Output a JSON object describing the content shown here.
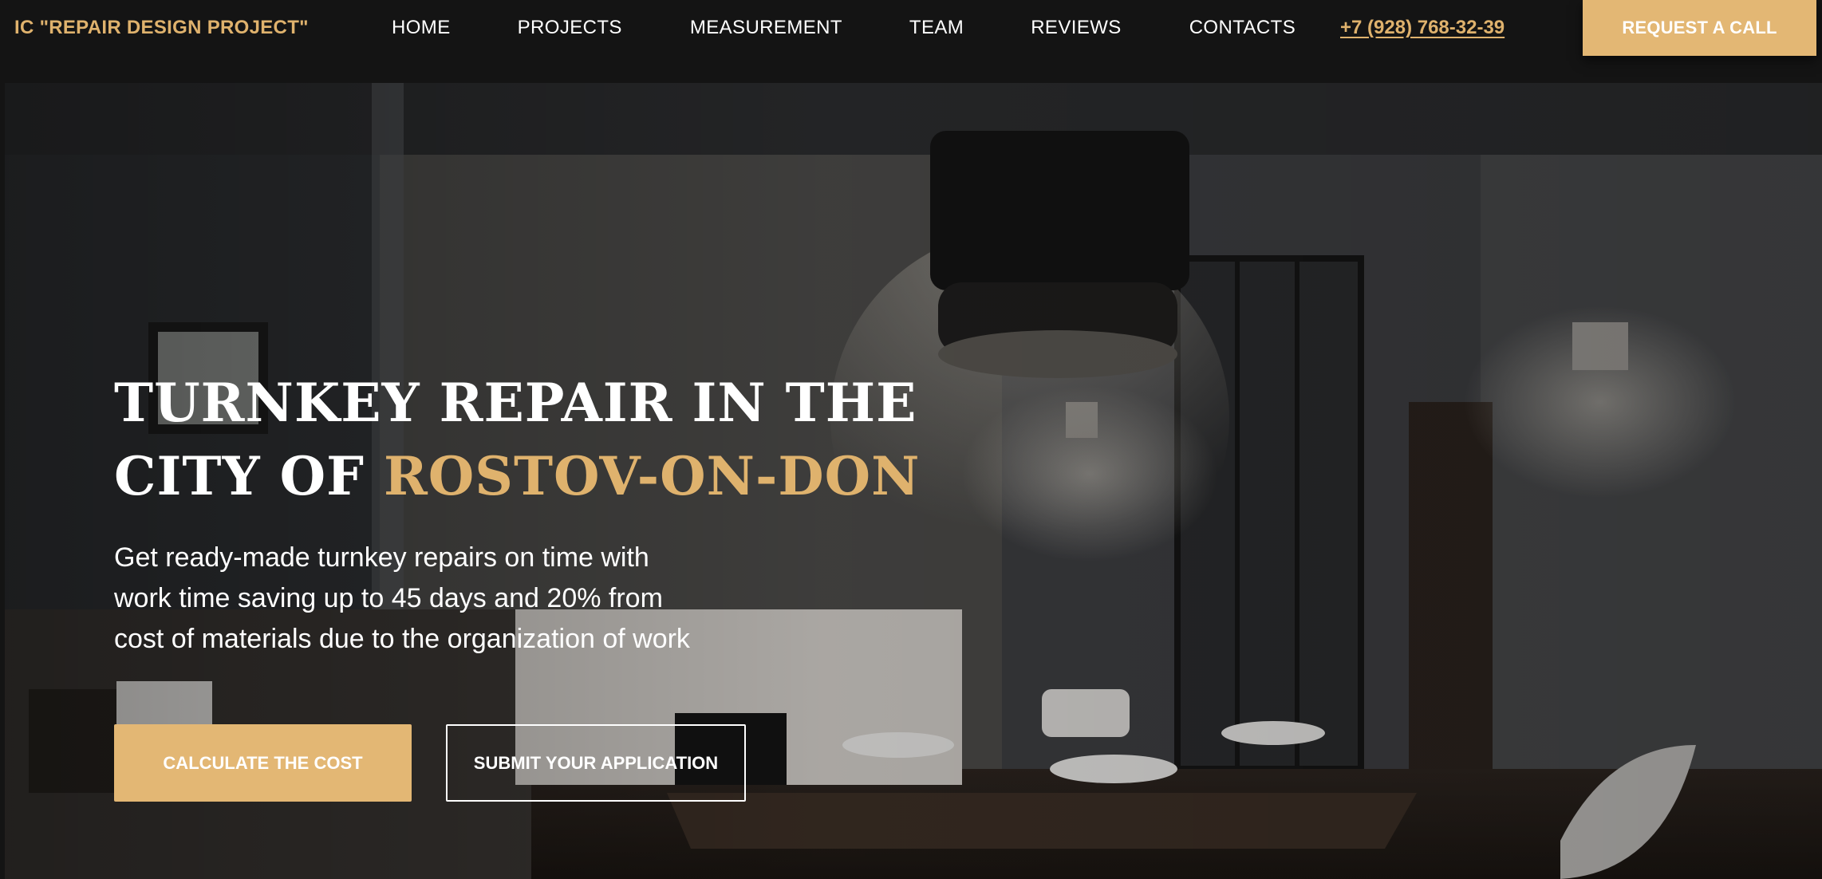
{
  "header": {
    "logo": "IC \"REPAIR DESIGN PROJECT\"",
    "nav": [
      "HOME",
      "PROJECTS",
      "MEASUREMENT",
      "TEAM",
      "REVIEWS",
      "CONTACTS"
    ],
    "phone": "+7 (928) 768-32-39",
    "request_label": "REQUEST A CALL"
  },
  "hero": {
    "title_line1": "TURNKEY REPAIR IN THE",
    "title_line2_prefix": "CITY OF ",
    "title_line2_accent": "ROSTOV-ON-DON",
    "subtitle_lines": [
      "Get ready-made turnkey repairs on time with",
      "work time saving up to 45 days and 20% from",
      "cost of materials due to the organization of work"
    ],
    "primary_button": "CALCULATE THE COST",
    "secondary_button": "SUBMIT YOUR APPLICATION"
  },
  "colors": {
    "accent": "#dfb26d",
    "header_bg": "#141414",
    "text": "#ffffff"
  }
}
